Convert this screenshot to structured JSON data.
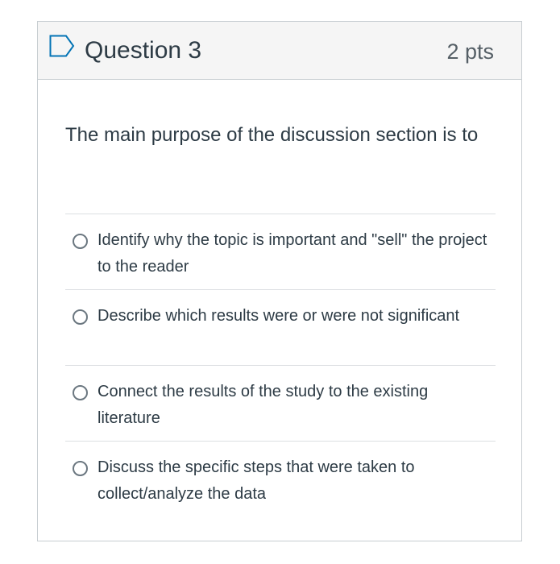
{
  "question": {
    "title": "Question 3",
    "points": "2 pts",
    "text": "The main purpose of the discussion section is to",
    "flag_icon": "flag-outline-icon"
  },
  "answers": [
    {
      "label": "Identify why the topic is important and \"sell\" the project to the reader",
      "selected": false
    },
    {
      "label": "Describe which results were or were not significant",
      "selected": false
    },
    {
      "label": "Connect the results of the study to the existing literature",
      "selected": false
    },
    {
      "label": "Discuss the specific steps that were taken to collect/analyze the data",
      "selected": false
    }
  ],
  "colors": {
    "header_bg": "#f5f5f5",
    "border": "#c7cdd1",
    "flag_stroke": "#0374b5",
    "text": "#2d3b45"
  }
}
